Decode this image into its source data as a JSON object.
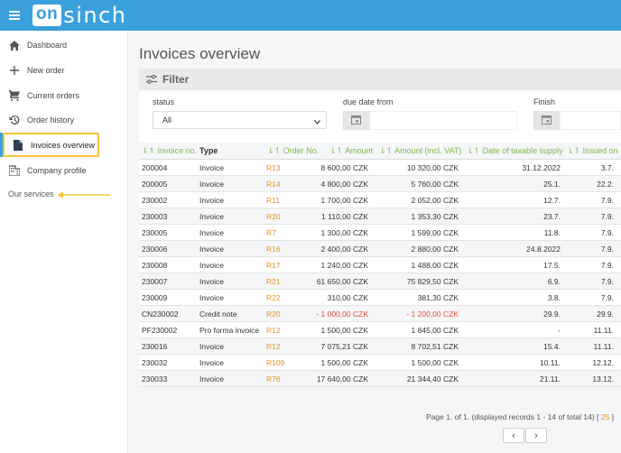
{
  "app": {
    "logo_box": "on",
    "logo_rest": "sinch"
  },
  "sidebar": {
    "items": [
      {
        "label": "Dashboard",
        "icon": "home-icon"
      },
      {
        "label": "New order",
        "icon": "plus-icon"
      },
      {
        "label": "Current orders",
        "icon": "cart-icon"
      },
      {
        "label": "Order history",
        "icon": "history-icon"
      },
      {
        "label": "Invoices overview",
        "icon": "document-icon",
        "active": true
      },
      {
        "label": "Company profile",
        "icon": "building-icon"
      }
    ],
    "services_label": "Our services"
  },
  "main": {
    "title": "Invoices overview"
  },
  "filter": {
    "heading": "Filter",
    "status_label": "status",
    "status_value": "All",
    "due_date_label": "due date from",
    "finish_label": "Finish"
  },
  "table": {
    "columns": [
      "Invoice no.",
      "Type",
      "Order No.",
      "Amount",
      "Amount (incl. VAT)",
      "Date of taxable supply",
      "Issued on"
    ],
    "rows": [
      {
        "invoice": "200004",
        "type": "Invoice",
        "order": "R13",
        "amount": "8 600,00 CZK",
        "vat": "10 320,00 CZK",
        "taxable": "31.12.2022",
        "issued": "3.7."
      },
      {
        "invoice": "200005",
        "type": "Invoice",
        "order": "R14",
        "amount": "4 800,00 CZK",
        "vat": "5 760,00 CZK",
        "taxable": "25.1.",
        "issued": "22.2."
      },
      {
        "invoice": "230002",
        "type": "Invoice",
        "order": "R11",
        "amount": "1 700,00 CZK",
        "vat": "2 052,00 CZK",
        "taxable": "12.7.",
        "issued": "7.9."
      },
      {
        "invoice": "230003",
        "type": "Invoice",
        "order": "R20",
        "amount": "1 110,00 CZK",
        "vat": "1 353,30 CZK",
        "taxable": "23.7.",
        "issued": "7.9."
      },
      {
        "invoice": "230005",
        "type": "Invoice",
        "order": "R7",
        "amount": "1 300,00 CZK",
        "vat": "1 599,00 CZK",
        "taxable": "11.8.",
        "issued": "7.9."
      },
      {
        "invoice": "230006",
        "type": "Invoice",
        "order": "R16",
        "amount": "2 400,00 CZK",
        "vat": "2 880,00 CZK",
        "taxable": "24.8.2022",
        "issued": "7.9."
      },
      {
        "invoice": "230008",
        "type": "Invoice",
        "order": "R17",
        "amount": "1 240,00 CZK",
        "vat": "1 488,00 CZK",
        "taxable": "17.5.",
        "issued": "7.9."
      },
      {
        "invoice": "230007",
        "type": "Invoice",
        "order": "R21",
        "amount": "61 650,00 CZK",
        "vat": "75 829,50 CZK",
        "taxable": "6.9.",
        "issued": "7.9."
      },
      {
        "invoice": "230009",
        "type": "Invoice",
        "order": "R22",
        "amount": "310,00 CZK",
        "vat": "381,30 CZK",
        "taxable": "3.8.",
        "issued": "7.9."
      },
      {
        "invoice": "CN230002",
        "type": "Credit note",
        "order": "R20",
        "amount": "- 1 000,00 CZK",
        "vat": "- 1 200,00 CZK",
        "taxable": "29.9.",
        "issued": "29.9.",
        "negative": true
      },
      {
        "invoice": "PF230002",
        "type": "Pro forma invoice",
        "order": "R12",
        "amount": "1 500,00 CZK",
        "vat": "1 845,00 CZK",
        "taxable": "-",
        "issued": "11.11."
      },
      {
        "invoice": "230016",
        "type": "Invoice",
        "order": "R12",
        "amount": "7 075,21 CZK",
        "vat": "8 702,51 CZK",
        "taxable": "15.4.",
        "issued": "11.11."
      },
      {
        "invoice": "230032",
        "type": "Invoice",
        "order": "R109",
        "amount": "1 500,00 CZK",
        "vat": "1 500,00 CZK",
        "taxable": "10.11.",
        "issued": "12.12."
      },
      {
        "invoice": "230033",
        "type": "Invoice",
        "order": "R76",
        "amount": "17 640,00 CZK",
        "vat": "21 344,40 CZK",
        "taxable": "21.11.",
        "issued": "13.12."
      }
    ]
  },
  "pagination": {
    "info": "Page 1. of 1. (displayed records 1 - 14 of total 14)",
    "open_bracket": "[",
    "page_size": "25",
    "close_bracket": "]",
    "prev": "‹",
    "next": "›"
  },
  "colors": {
    "brand": "#3aa0dc",
    "accent_orange": "#e69423",
    "sort_green": "#7bb84a",
    "highlight_yellow": "#f2c438",
    "negative_red": "#e04b3a"
  }
}
